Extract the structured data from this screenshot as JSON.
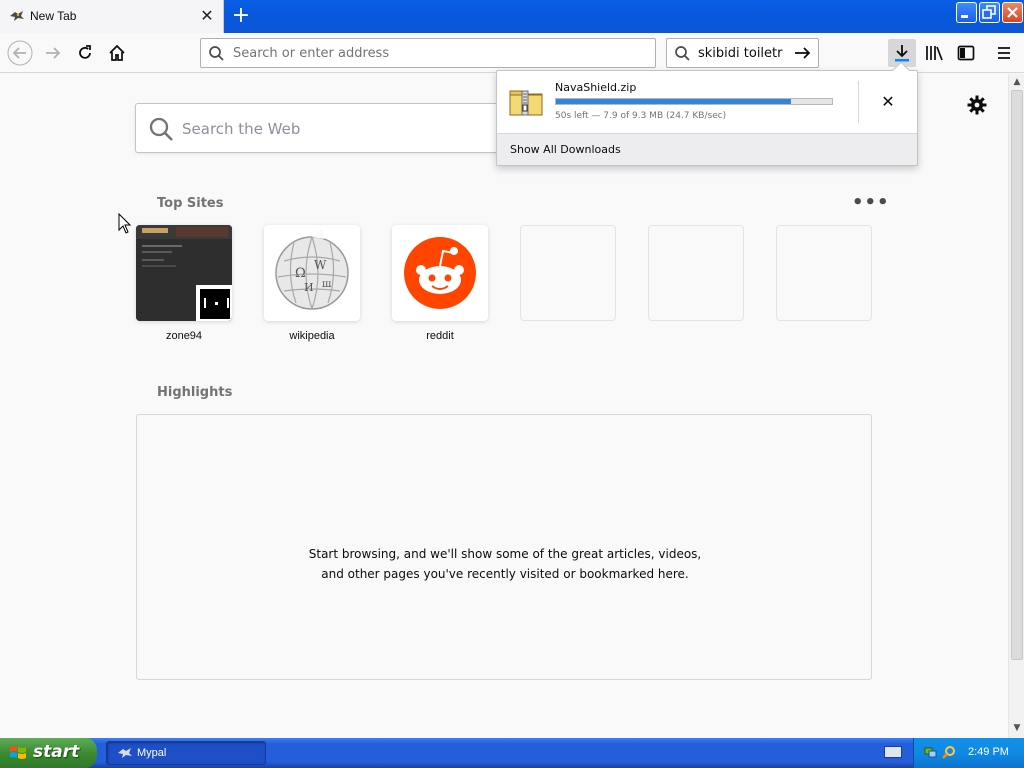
{
  "browser": {
    "tab_title": "New Tab",
    "tab_close": "✕",
    "new_tab": "+",
    "url_placeholder": "Search or enter address",
    "search_value": "skibidi toiletr"
  },
  "downloads_panel": {
    "file_name": "NavaShield.zip",
    "status": "50s left — 7.9 of 9.3 MB (24.7 KB/sec)",
    "progress_fraction": 0.85,
    "cancel": "✕",
    "show_all_label": "Show All Downloads"
  },
  "newtab_page": {
    "search_placeholder": "Search the Web",
    "top_sites_title": "Top Sites",
    "more_menu": "•••",
    "top_sites": [
      {
        "label": "zone94"
      },
      {
        "label": "wikipedia"
      },
      {
        "label": "reddit"
      }
    ],
    "highlights_title": "Highlights",
    "highlights_message": "Start browsing, and we'll show some of the great articles, videos, and other pages you've recently visited or bookmarked here."
  },
  "taskbar": {
    "start_label": "start",
    "task_label": "Mypal",
    "clock": "2:49 PM"
  },
  "colors": {
    "accent": "#0a84ff",
    "progress": "#3484db",
    "reddit": "#ff4500",
    "xp_taskbar": "#245edb",
    "xp_start": "#3c8a32"
  },
  "icons": [
    "mypal-icon",
    "close-icon",
    "plus-icon",
    "back-icon",
    "forward-icon",
    "reload-icon",
    "home-icon",
    "search-icon",
    "arrow-right-icon",
    "download-icon",
    "library-icon",
    "sidebar-icon",
    "menu-icon",
    "gear-icon",
    "zip-file-icon",
    "wikipedia-logo",
    "reddit-logo",
    "windows-flag-icon"
  ]
}
